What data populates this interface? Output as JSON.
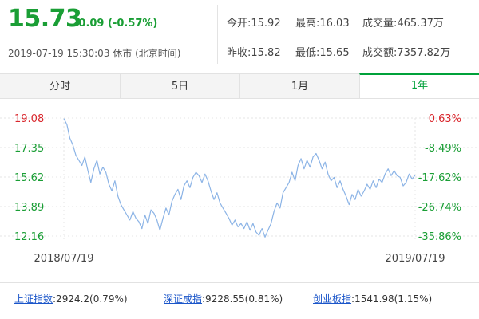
{
  "quote": {
    "price": "15.73",
    "change": "-0.09 (-0.57%)",
    "timestamp": "2019-07-19 15:30:03 休市 (北京时间)",
    "up_color": "#d9262c",
    "down_color": "#1a9e35"
  },
  "stats": {
    "open": "今开:15.92",
    "high": "最高:16.03",
    "volume": "成交量:465.37万",
    "prev_close": "昨收:15.82",
    "low": "最低:15.65",
    "turnover": "成交额:7357.82万"
  },
  "tabs": [
    {
      "label": "分时",
      "active": false
    },
    {
      "label": "5日",
      "active": false
    },
    {
      "label": "1月",
      "active": false
    },
    {
      "label": "1年",
      "active": true
    }
  ],
  "chart_data": {
    "type": "line",
    "x_start_label": "2018/07/19",
    "x_end_label": "2019/07/19",
    "ylim": [
      12.16,
      19.08
    ],
    "y_ticks": [
      "19.08",
      "17.35",
      "15.62",
      "13.89",
      "12.16"
    ],
    "y_ticks_right": [
      "0.63%",
      "-8.49%",
      "-17.62%",
      "-26.74%",
      "-35.86%"
    ],
    "line_color": "#8cb4e6",
    "series": [
      {
        "values": [
          19.05,
          18.7,
          17.9,
          17.5,
          16.9,
          16.6,
          16.3,
          16.8,
          16.0,
          15.3,
          16.1,
          16.6,
          15.8,
          16.2,
          15.9,
          15.2,
          14.8,
          15.4,
          14.5,
          14.0,
          13.7,
          13.4,
          13.1,
          13.6,
          13.2,
          13.0,
          12.6,
          13.4,
          12.9,
          13.7,
          13.5,
          13.1,
          12.5,
          13.2,
          13.8,
          13.4,
          14.2,
          14.6,
          14.9,
          14.3,
          15.1,
          15.4,
          15.0,
          15.6,
          15.9,
          15.7,
          15.3,
          15.8,
          15.4,
          14.8,
          14.3,
          14.7,
          14.1,
          13.8,
          13.5,
          13.2,
          12.8,
          13.1,
          12.7,
          12.9,
          12.6,
          13.0,
          12.5,
          12.9,
          12.4,
          12.2,
          12.6,
          12.1,
          12.5,
          12.9,
          13.6,
          14.1,
          13.8,
          14.7,
          15.0,
          15.3,
          15.9,
          15.4,
          16.3,
          16.7,
          16.1,
          16.6,
          16.2,
          16.8,
          17.0,
          16.6,
          16.1,
          16.5,
          15.8,
          15.4,
          15.6,
          15.0,
          15.4,
          14.9,
          14.5,
          14.0,
          14.6,
          14.3,
          14.9,
          14.5,
          14.8,
          15.2,
          14.9,
          15.4,
          15.0,
          15.5,
          15.3,
          15.8,
          16.1,
          15.7,
          16.0,
          15.7,
          15.6,
          15.1,
          15.3,
          15.8,
          15.5,
          15.73
        ]
      }
    ]
  },
  "indices": [
    {
      "name": "上证指数",
      "value": ":2924.2(0.79%)"
    },
    {
      "name": "深证成指",
      "value": ":9228.55(0.81%)"
    },
    {
      "name": "创业板指",
      "value": ":1541.98(1.15%)"
    }
  ]
}
